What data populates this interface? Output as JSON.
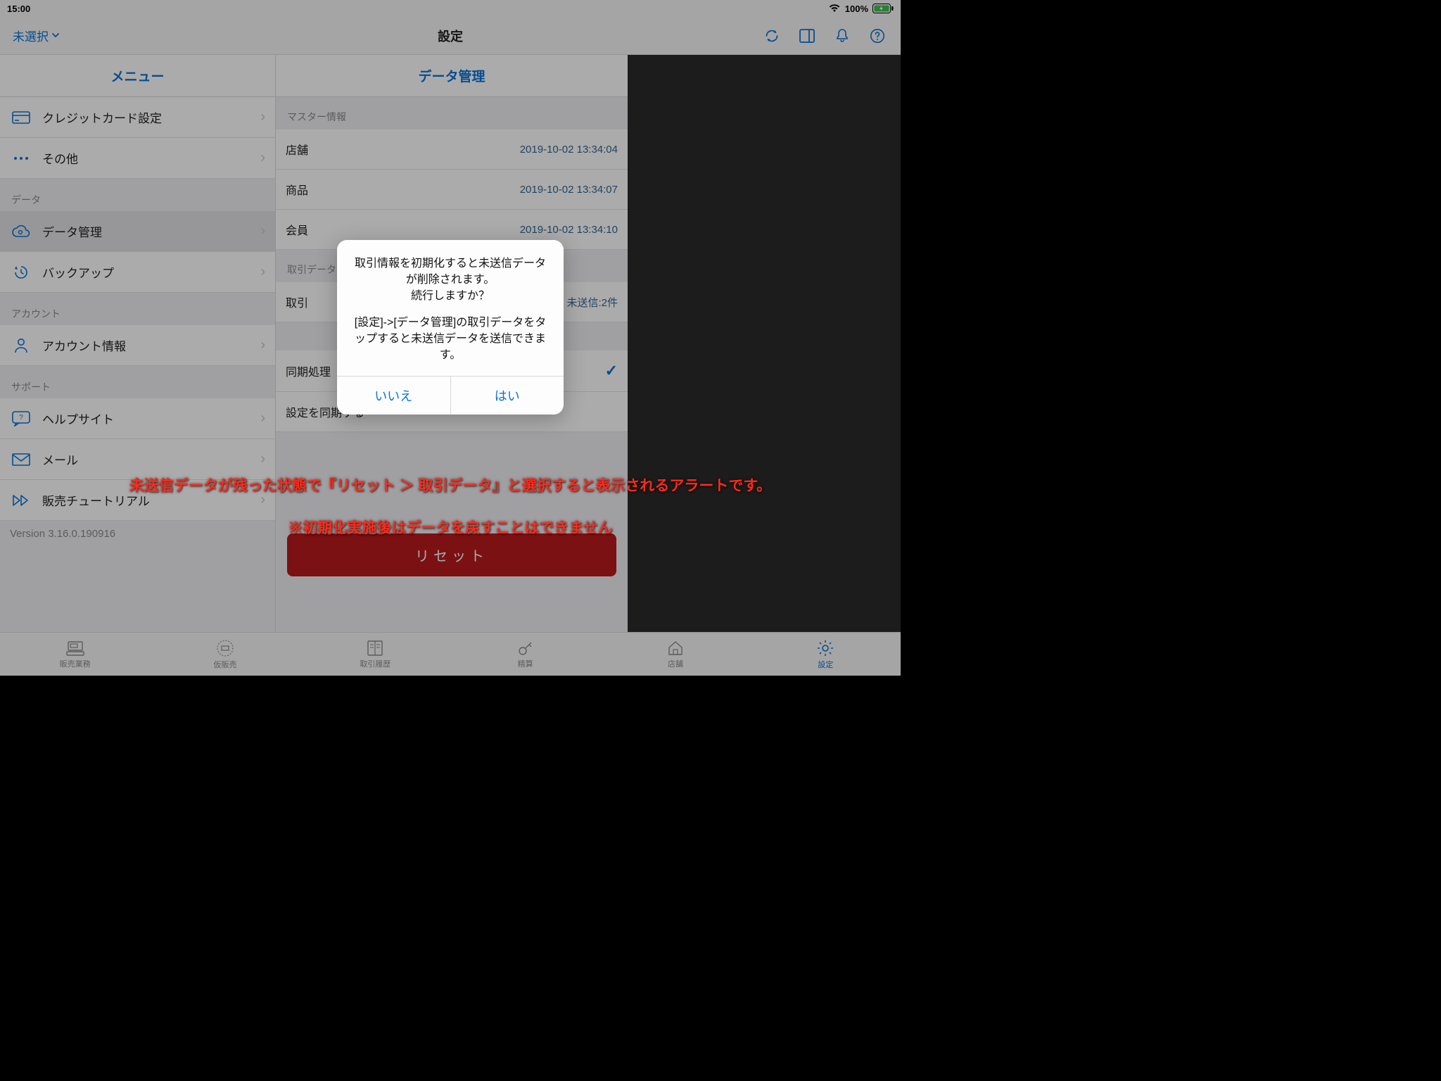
{
  "status": {
    "time": "15:00",
    "battery": "100%"
  },
  "nav": {
    "left_label": "未選択",
    "title": "設定"
  },
  "sidebar": {
    "header": "メニュー",
    "sections": [
      {
        "label": null,
        "items": [
          {
            "icon": "credit-card-icon",
            "label": "クレジットカード設定"
          },
          {
            "icon": "ellipsis-icon",
            "label": "その他"
          }
        ]
      },
      {
        "label": "データ",
        "items": [
          {
            "icon": "cloud-icon",
            "label": "データ管理",
            "selected": true
          },
          {
            "icon": "history-icon",
            "label": "バックアップ"
          }
        ]
      },
      {
        "label": "アカウント",
        "items": [
          {
            "icon": "user-icon",
            "label": "アカウント情報"
          }
        ]
      },
      {
        "label": "サポート",
        "items": [
          {
            "icon": "help-chat-icon",
            "label": "ヘルプサイト"
          },
          {
            "icon": "mail-icon",
            "label": "メール"
          },
          {
            "icon": "forward-icon",
            "label": "販売チュートリアル"
          }
        ]
      }
    ],
    "version": "Version 3.16.0.190916"
  },
  "main": {
    "header": "データ管理",
    "master_label": "マスター情報",
    "master_rows": [
      {
        "name": "店舗",
        "ts": "2019-10-02 13:34:04"
      },
      {
        "name": "商品",
        "ts": "2019-10-02 13:34:07"
      },
      {
        "name": "会員",
        "ts": "2019-10-02 13:34:10"
      }
    ],
    "txn_label": "取引データ",
    "txn_row": {
      "name": "取引",
      "status": "未送信:2件"
    },
    "sync_label": "同期処理",
    "sync_row": "設定を同期する",
    "reset": "リセット"
  },
  "alert": {
    "line1": "取引情報を初期化すると未送信データが削除されます。",
    "line2": "続行しますか？",
    "line3": "[設定]->[データ管理]の取引データをタップすると未送信データを送信できます。",
    "no": "いいえ",
    "yes": "はい"
  },
  "tabs": [
    {
      "icon": "register-icon",
      "label": "販売業務"
    },
    {
      "icon": "hold-icon",
      "label": "仮販売"
    },
    {
      "icon": "book-icon",
      "label": "取引履歴"
    },
    {
      "icon": "key-icon",
      "label": "精算"
    },
    {
      "icon": "home-icon",
      "label": "店舗"
    },
    {
      "icon": "gear-icon",
      "label": "設定",
      "active": true
    }
  ],
  "annotations": {
    "a1": "未送信データが残った状態で『リセット ＞ 取引データ』と選択すると表示されるアラートです。",
    "a2": "※初期化実施後はデータを戻すことはできません"
  }
}
